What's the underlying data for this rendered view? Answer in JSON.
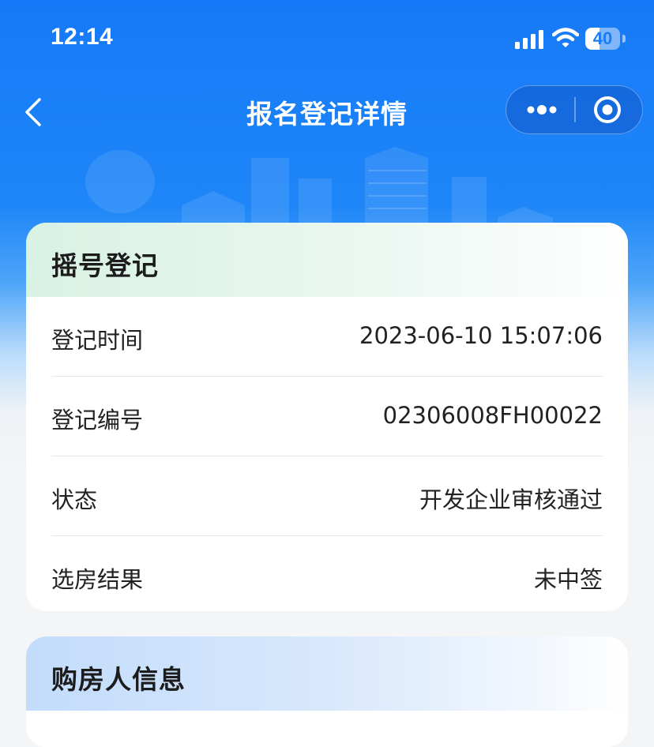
{
  "status_bar": {
    "time": "12:14",
    "battery_level": "40",
    "battery_fill_fraction": 0.4
  },
  "nav": {
    "title": "报名登记详情"
  },
  "registration_card": {
    "title": "摇号登记",
    "rows": [
      {
        "label": "登记时间",
        "value": "2023-06-10 15:07:06"
      },
      {
        "label": "登记编号",
        "value": "02306008FH00022"
      },
      {
        "label": "状态",
        "value": "开发企业审核通过"
      },
      {
        "label": "选房结果",
        "value": "未中签"
      }
    ]
  },
  "buyer_card": {
    "title": "购房人信息"
  },
  "colors": {
    "primary_blue": "#1679f7",
    "card_bg": "#ffffff",
    "page_bg": "#f4f5f7",
    "text_primary": "#222222"
  }
}
